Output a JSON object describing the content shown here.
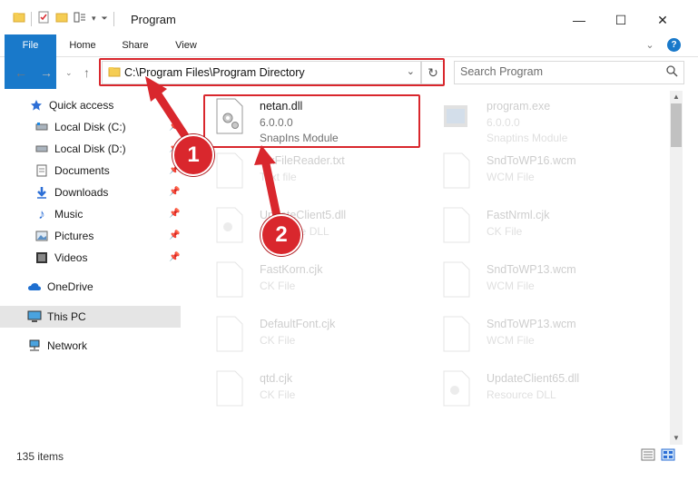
{
  "window": {
    "title": "Program",
    "help_icon": "?",
    "minimize_label": "—",
    "maximize_label": "☐",
    "close_label": "✕",
    "chevron": "⌄"
  },
  "ribbon": {
    "tabs": [
      "File",
      "Home",
      "Share",
      "View"
    ]
  },
  "address": {
    "path": "C:\\Program Files\\Program Directory",
    "search_placeholder": "Search Program"
  },
  "nav_pane": {
    "quick_access": "Quick access",
    "items": [
      {
        "label": "Local Disk (C:)",
        "icon": "drive-icon",
        "pinned": true
      },
      {
        "label": "Local Disk (D:)",
        "icon": "drive-icon",
        "pinned": true
      },
      {
        "label": "Documents",
        "icon": "documents-icon",
        "pinned": true
      },
      {
        "label": "Downloads",
        "icon": "downloads-icon",
        "pinned": true
      },
      {
        "label": "Music",
        "icon": "music-icon",
        "pinned": true
      },
      {
        "label": "Pictures",
        "icon": "pictures-icon",
        "pinned": true
      },
      {
        "label": "Videos",
        "icon": "videos-icon",
        "pinned": true
      }
    ],
    "onedrive": "OneDrive",
    "this_pc": "This PC",
    "network": "Network"
  },
  "files": [
    {
      "name": "netan.dll",
      "line2": "6.0.0.0",
      "line3": "SnapIns Module",
      "icon": "dll-gear-icon",
      "highlighted": true
    },
    {
      "name": "program.exe",
      "line2": "6.0.0.0",
      "line3": "Snaptins Module",
      "icon": "exe-icon",
      "highlighted": false
    },
    {
      "name": "FixFileReader.txt",
      "line2": "Text file",
      "line3": "",
      "icon": "file-icon",
      "highlighted": false
    },
    {
      "name": "SndToWP16.wcm",
      "line2": "WCM File",
      "line3": "",
      "icon": "file-icon",
      "highlighted": false
    },
    {
      "name": "UpdateClient5.dll",
      "line2": "Resource DLL",
      "line3": "",
      "icon": "dll-gear-icon",
      "highlighted": false
    },
    {
      "name": "FastNrml.cjk",
      "line2": "CK File",
      "line3": "",
      "icon": "file-icon",
      "highlighted": false
    },
    {
      "name": "FastKorn.cjk",
      "line2": "CK File",
      "line3": "",
      "icon": "file-icon",
      "highlighted": false
    },
    {
      "name": "SndToWP13.wcm",
      "line2": "WCM File",
      "line3": "",
      "icon": "file-icon",
      "highlighted": false
    },
    {
      "name": "DefaultFont.cjk",
      "line2": "CK File",
      "line3": "",
      "icon": "file-icon",
      "highlighted": false
    },
    {
      "name": "SndToWP13.wcm",
      "line2": "WCM File",
      "line3": "",
      "icon": "file-icon",
      "highlighted": false
    },
    {
      "name": "qtd.cjk",
      "line2": "CK File",
      "line3": "",
      "icon": "file-icon",
      "highlighted": false
    },
    {
      "name": "UpdateClient65.dll",
      "line2": "Resource DLL",
      "line3": "",
      "icon": "dll-gear-icon",
      "highlighted": false
    }
  ],
  "status": {
    "items_count": "135 items"
  },
  "annotations": {
    "step1": "1",
    "step2": "2",
    "color": "#d9272d"
  },
  "colors": {
    "accent": "#1979ca",
    "highlight": "#d9272d"
  }
}
